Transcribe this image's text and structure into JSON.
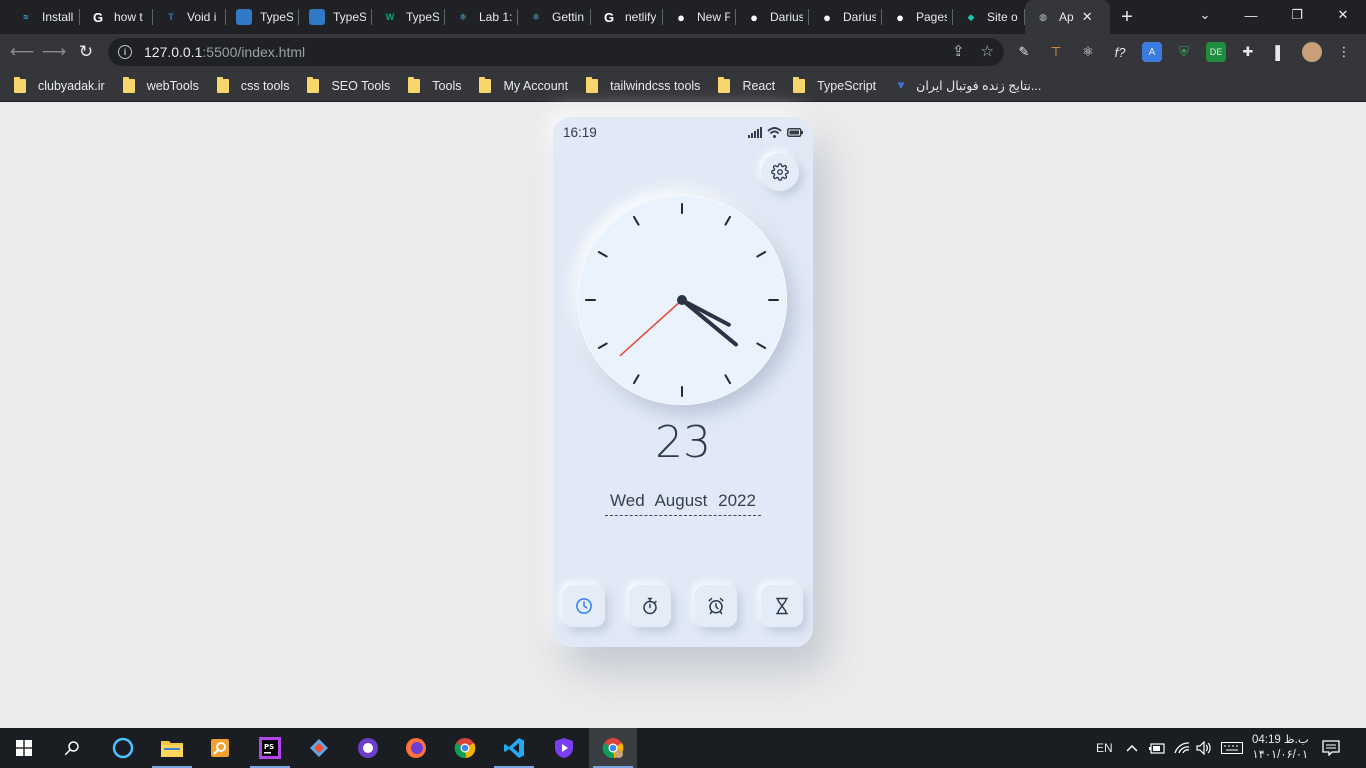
{
  "browser": {
    "tabs": [
      {
        "title": "Install",
        "icon": "tailwind-icon",
        "color": "#38bdf8"
      },
      {
        "title": "how t",
        "icon": "google-icon",
        "color": "#ffffff"
      },
      {
        "title": "Void i",
        "icon": "typescript-play-icon",
        "color": "#3178c6"
      },
      {
        "title": "TypeS",
        "icon": "typescript-icon",
        "color": "#3178c6"
      },
      {
        "title": "TypeS",
        "icon": "typescript-icon",
        "color": "#3178c6"
      },
      {
        "title": "TypeS",
        "icon": "w3schools-icon",
        "color": "#04aa6d"
      },
      {
        "title": "Lab 1:",
        "icon": "react-icon",
        "color": "#61dafb"
      },
      {
        "title": "Gettin",
        "icon": "react-icon",
        "color": "#61dafb"
      },
      {
        "title": "netlify",
        "icon": "google-icon",
        "color": "#ffffff"
      },
      {
        "title": "New F",
        "icon": "github-icon",
        "color": "#ffffff"
      },
      {
        "title": "Darius",
        "icon": "github-icon",
        "color": "#ffffff"
      },
      {
        "title": "Darius",
        "icon": "github-icon",
        "color": "#ffffff"
      },
      {
        "title": "Pages",
        "icon": "github-icon",
        "color": "#ffffff"
      },
      {
        "title": "Site o",
        "icon": "netlify-icon",
        "color": "#20c6b7"
      },
      {
        "title": "Ap",
        "icon": "globe-icon",
        "color": "#bdc1c6",
        "active": true
      }
    ],
    "url_host": "127.0.0.1",
    "url_path": ":5500/index.html",
    "bookmarks": [
      {
        "label": "clubyadak.ir",
        "type": "folder"
      },
      {
        "label": "webTools",
        "type": "folder"
      },
      {
        "label": "css tools",
        "type": "folder"
      },
      {
        "label": "SEO Tools",
        "type": "folder"
      },
      {
        "label": "Tools",
        "type": "folder"
      },
      {
        "label": "My Account",
        "type": "folder"
      },
      {
        "label": "tailwindcss tools",
        "type": "folder"
      },
      {
        "label": "React",
        "type": "folder"
      },
      {
        "label": "TypeScript",
        "type": "folder"
      },
      {
        "label": "نتایج زنده فوتبال ایران...",
        "type": "link"
      }
    ]
  },
  "app": {
    "status_time": "16:19",
    "clock": {
      "hour": 4,
      "minute": 19,
      "second": 38
    },
    "day": "23",
    "weekday": "Wed",
    "month": "August",
    "year": "2022",
    "accent": "#2f80ed",
    "second_hand_color": "#e74c3c",
    "dock": [
      {
        "name": "clock-icon",
        "active": true
      },
      {
        "name": "stopwatch-icon",
        "active": false
      },
      {
        "name": "alarm-icon",
        "active": false
      },
      {
        "name": "hourglass-icon",
        "active": false
      }
    ]
  },
  "taskbar": {
    "lang": "EN",
    "time": "04:19 ب.ظ",
    "date": "۱۴۰۱/۰۶/۰۱"
  }
}
